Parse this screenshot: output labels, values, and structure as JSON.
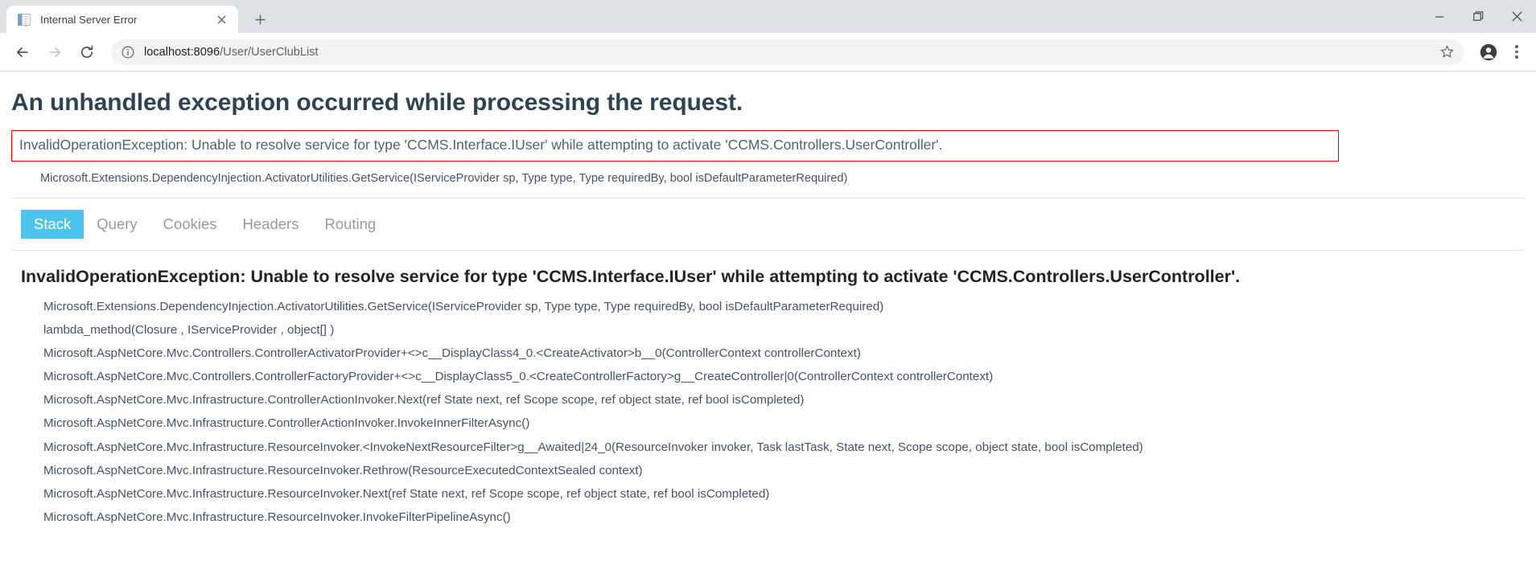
{
  "browser": {
    "tab": {
      "title": "Internal Server Error",
      "favicon_icon": "document-page-icon",
      "close_icon": "close-icon"
    },
    "new_tab_icon": "plus-icon",
    "window_controls": {
      "minimize_icon": "minimize-icon",
      "maximize_icon": "restore-window-icon",
      "close_icon": "close-window-icon"
    },
    "toolbar": {
      "back_icon": "arrow-left-icon",
      "forward_icon": "arrow-right-icon",
      "reload_icon": "reload-icon",
      "info_icon": "info-circle-icon",
      "url_host": "localhost:8096",
      "url_path": "/User/UserClubList",
      "url_full": "localhost:8096/User/UserClubList",
      "bookmark_icon": "star-icon",
      "profile_icon": "account-avatar-icon",
      "menu_icon": "three-dot-menu-icon"
    }
  },
  "page": {
    "heading": "An unhandled exception occurred while processing the request.",
    "error_box": {
      "message": "InvalidOperationException: Unable to resolve service for type 'CCMS.Interface.IUser' while attempting to activate 'CCMS.Controllers.UserController'.",
      "border_color": "#e60000"
    },
    "error_subline": "Microsoft.Extensions.DependencyInjection.ActivatorUtilities.GetService(IServiceProvider sp, Type type, Type requiredBy, bool isDefaultParameterRequired)",
    "tabs": [
      {
        "label": "Stack",
        "active": true
      },
      {
        "label": "Query",
        "active": false
      },
      {
        "label": "Cookies",
        "active": false
      },
      {
        "label": "Headers",
        "active": false
      },
      {
        "label": "Routing",
        "active": false
      }
    ],
    "active_tab_color": "#4ec3ee",
    "stack_heading": "InvalidOperationException: Unable to resolve service for type 'CCMS.Interface.IUser' while attempting to activate 'CCMS.Controllers.UserController'.",
    "stack_frames": [
      "Microsoft.Extensions.DependencyInjection.ActivatorUtilities.GetService(IServiceProvider sp, Type type, Type requiredBy, bool isDefaultParameterRequired)",
      "lambda_method(Closure , IServiceProvider , object[] )",
      "Microsoft.AspNetCore.Mvc.Controllers.ControllerActivatorProvider+<>c__DisplayClass4_0.<CreateActivator>b__0(ControllerContext controllerContext)",
      "Microsoft.AspNetCore.Mvc.Controllers.ControllerFactoryProvider+<>c__DisplayClass5_0.<CreateControllerFactory>g__CreateController|0(ControllerContext controllerContext)",
      "Microsoft.AspNetCore.Mvc.Infrastructure.ControllerActionInvoker.Next(ref State next, ref Scope scope, ref object state, ref bool isCompleted)",
      "Microsoft.AspNetCore.Mvc.Infrastructure.ControllerActionInvoker.InvokeInnerFilterAsync()",
      "Microsoft.AspNetCore.Mvc.Infrastructure.ResourceInvoker.<InvokeNextResourceFilter>g__Awaited|24_0(ResourceInvoker invoker, Task lastTask, State next, Scope scope, object state, bool isCompleted)",
      "Microsoft.AspNetCore.Mvc.Infrastructure.ResourceInvoker.Rethrow(ResourceExecutedContextSealed context)",
      "Microsoft.AspNetCore.Mvc.Infrastructure.ResourceInvoker.Next(ref State next, ref Scope scope, ref object state, ref bool isCompleted)",
      "Microsoft.AspNetCore.Mvc.Infrastructure.ResourceInvoker.InvokeFilterPipelineAsync()"
    ]
  }
}
